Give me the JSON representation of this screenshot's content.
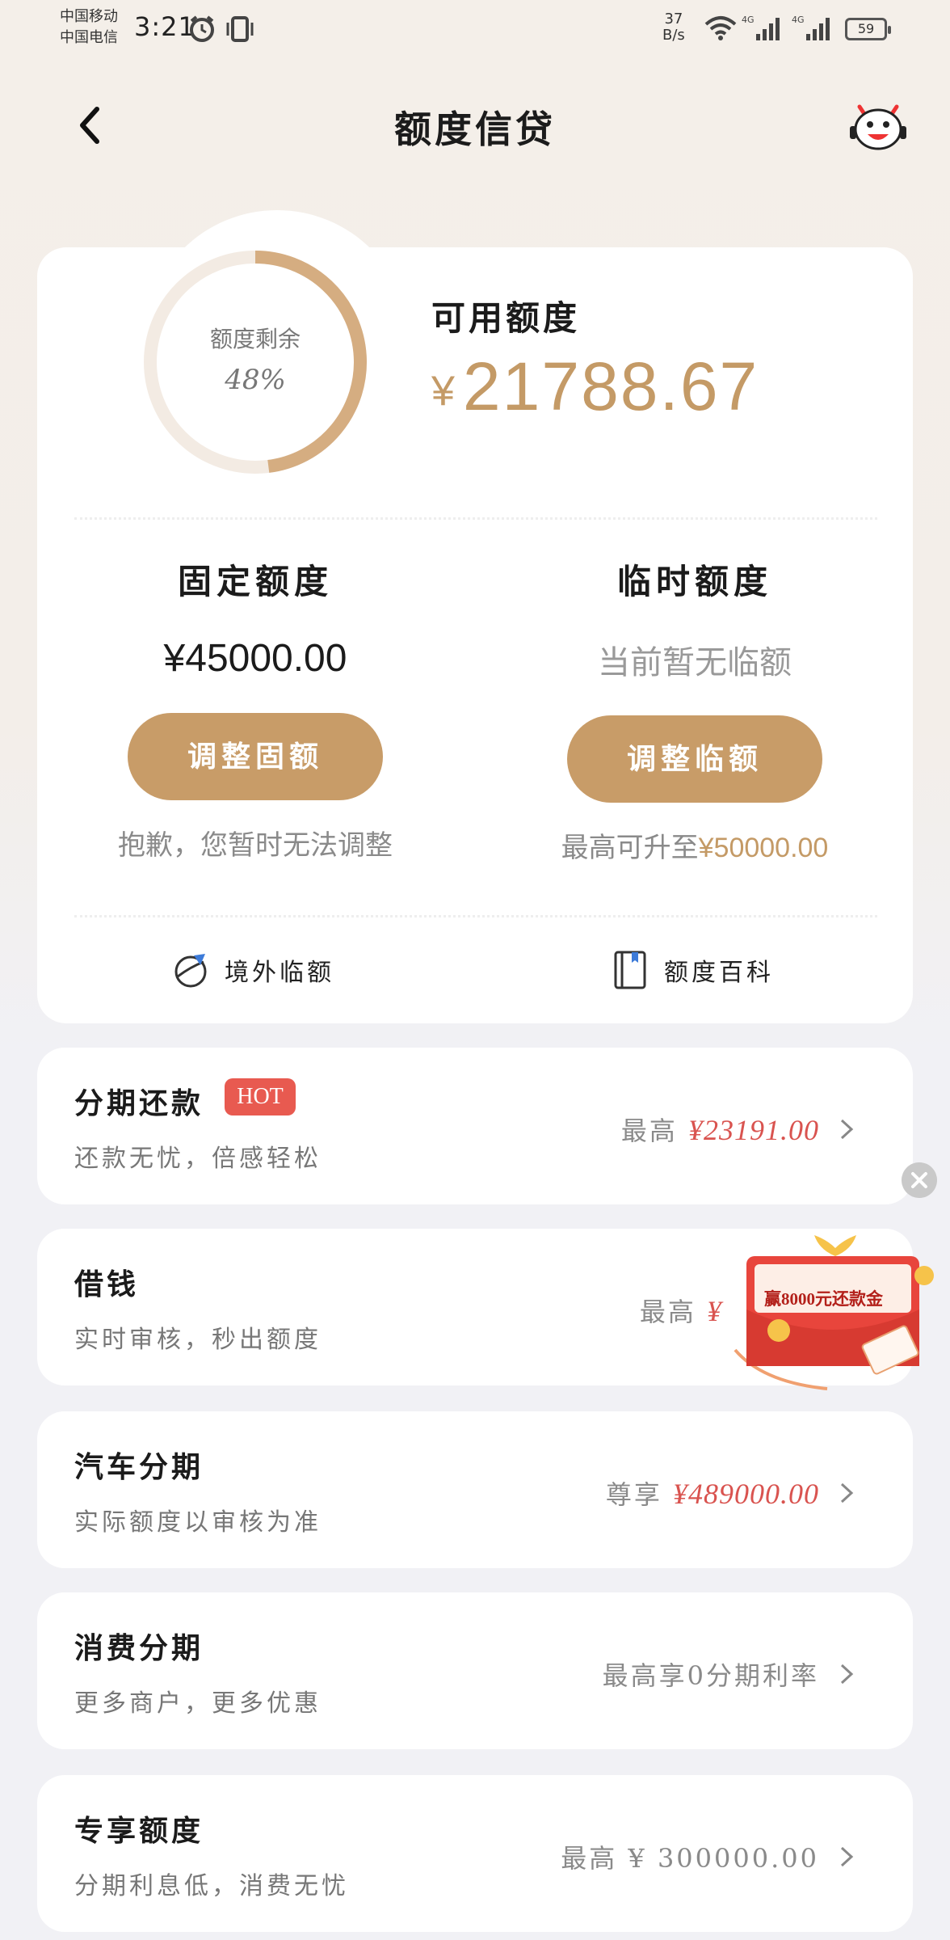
{
  "status": {
    "carrier1": "中国移动",
    "carrier2": "中国电信",
    "time": "3:21",
    "speed_value": "37",
    "speed_unit": "B/s",
    "battery": "59"
  },
  "nav": {
    "title": "额度信贷"
  },
  "summary": {
    "ring_label": "额度剩余",
    "ring_percent": "48%",
    "ring_fraction": 0.48,
    "available_label": "可用额度",
    "currency": "¥",
    "available_value": "21788.67"
  },
  "fixed": {
    "title": "固定额度",
    "value": "¥45000.00",
    "button": "调整固额",
    "note": "抱歉，您暂时无法调整"
  },
  "temp": {
    "title": "临时额度",
    "value": "当前暂无临额",
    "button": "调整临额",
    "note_prefix": "最高可升至",
    "note_amount": "¥50000.00"
  },
  "links": {
    "overseas": "境外临额",
    "wiki": "额度百科"
  },
  "items": [
    {
      "title": "分期还款",
      "badge": "HOT",
      "subtitle": "还款无忧，倍感轻松",
      "right_prefix": "最高",
      "right_value": "¥23191.00"
    },
    {
      "title": "借钱",
      "subtitle": "实时审核，秒出额度",
      "right_prefix": "最高",
      "right_value": "¥"
    },
    {
      "title": "汽车分期",
      "subtitle": "实际额度以审核为准",
      "right_prefix": "尊享",
      "right_value": "¥489000.00"
    },
    {
      "title": "消费分期",
      "subtitle": "更多商户，更多优惠",
      "right_text": "最高享0分期利率"
    },
    {
      "title": "专享额度",
      "subtitle": "分期利息低，消费无忧",
      "right_text": "最高 ¥ 300000.00"
    }
  ],
  "promo": {
    "text": "赢8000元还款金"
  },
  "colors": {
    "gold": "#c89c68",
    "red": "#d9534f",
    "hot": "#e85a50"
  }
}
